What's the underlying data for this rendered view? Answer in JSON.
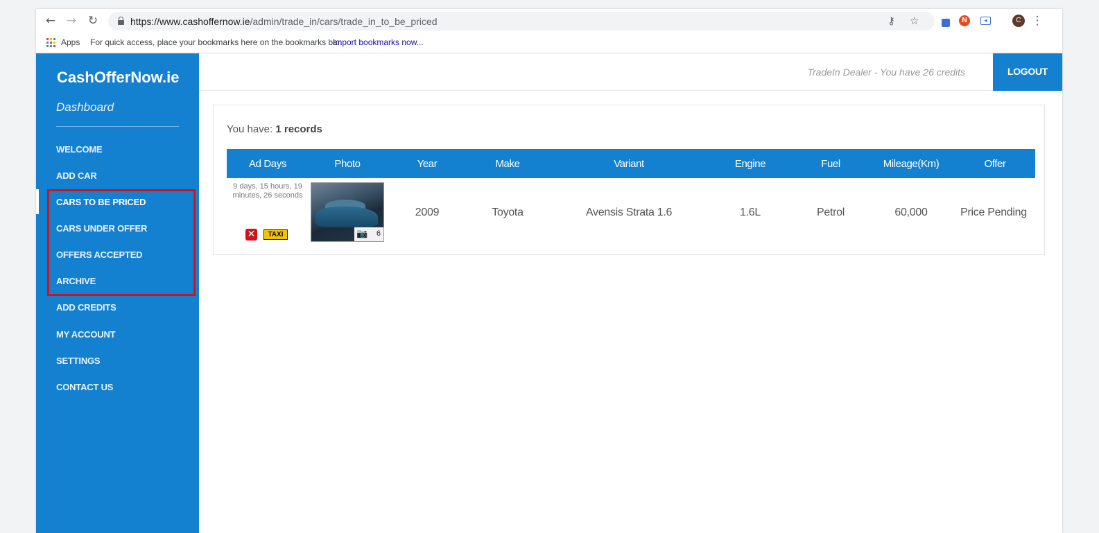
{
  "browser": {
    "url_host": "https://www.cashoffernow.ie",
    "url_path": "/admin/trade_in/cars/trade_in_to_be_priced",
    "profile_initial": "C",
    "bookmarks": {
      "apps_label": "Apps",
      "hint": "For quick access, place your bookmarks here on the bookmarks bar.",
      "import_link": "Import bookmarks now..."
    }
  },
  "sidebar": {
    "brand": "CashOfferNow.ie",
    "subtitle": "Dashboard",
    "items": [
      {
        "label": "WELCOME"
      },
      {
        "label": "ADD CAR"
      },
      {
        "label": "CARS TO BE PRICED"
      },
      {
        "label": "CARS UNDER OFFER"
      },
      {
        "label": "OFFERS ACCEPTED"
      },
      {
        "label": "ARCHIVE"
      },
      {
        "label": "ADD CREDITS"
      },
      {
        "label": "MY ACCOUNT"
      },
      {
        "label": "SETTINGS"
      },
      {
        "label": "CONTACT US"
      }
    ],
    "active_index": 2
  },
  "header": {
    "dealer_text": "TradeIn Dealer - You have 26 credits",
    "logout_label": "LOGOUT"
  },
  "main": {
    "records_prefix": "You have: ",
    "records_count": "1 records",
    "columns": [
      "Ad Days",
      "Photo",
      "Year",
      "Make",
      "Variant",
      "Engine",
      "Fuel",
      "Mileage(Km)",
      "Offer"
    ],
    "rows": [
      {
        "ad_days": "9 days, 15 hours, 19 minutes, 26 seconds",
        "taxi_label": "TAXI",
        "photo_count": "6",
        "year": "2009",
        "make": "Toyota",
        "variant": "Avensis Strata 1.6",
        "engine": "1.6L",
        "fuel": "Petrol",
        "mileage": "60,000",
        "offer": "Price Pending"
      }
    ]
  },
  "colors": {
    "brand_blue": "#1381d0",
    "highlight_red": "#d0121b"
  }
}
